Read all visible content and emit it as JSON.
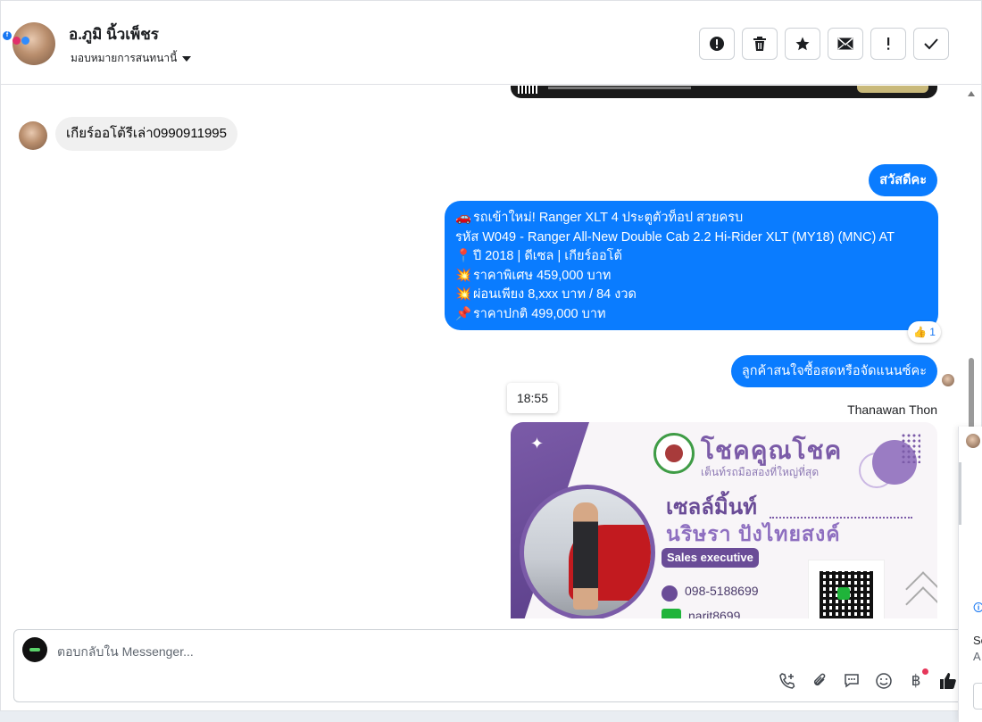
{
  "header": {
    "contact_name": "อ.ภูมิ นิ้วเพ็ชร",
    "assign_label": "มอบหมายการสนทนานี้",
    "badge_fb": "f",
    "actions": [
      {
        "name": "spam-button",
        "icon": "alert-circle-icon",
        "glyph": "!"
      },
      {
        "name": "delete-button",
        "icon": "trash-icon",
        "glyph": "🗑"
      },
      {
        "name": "star-button",
        "icon": "star-icon",
        "glyph": "★"
      },
      {
        "name": "mark-unread-button",
        "icon": "envelope-icon",
        "glyph": "✉"
      },
      {
        "name": "important-button",
        "icon": "exclamation-icon",
        "glyph": "!"
      },
      {
        "name": "mark-done-button",
        "icon": "check-icon",
        "glyph": "✓"
      }
    ]
  },
  "messages": {
    "incoming_1": "เกียร์ออโต้รีเล่า0990911995",
    "outgoing_1": "สวัสดีคะ",
    "outgoing_2": {
      "lines": [
        {
          "emoji": "🚗",
          "text": "รถเข้าใหม่! Ranger XLT 4 ประตูตัวท็อป สวยครบ"
        },
        {
          "emoji": "",
          "text": "รหัส W049 - Ranger All-New Double Cab 2.2 Hi-Rider XLT (MY18) (MNC) AT"
        },
        {
          "emoji": "📍",
          "text": "ปี 2018 | ดีเซล | เกียร์ออโต้"
        },
        {
          "emoji": "💥",
          "text": "ราคาพิเศษ 459,000 บาท"
        },
        {
          "emoji": "💥",
          "text": "ผ่อนเพียง 8,xxx บาท / 84 งวด"
        },
        {
          "emoji": "📌",
          "text": "ราคาปกติ 499,000 บาท"
        }
      ],
      "reaction": "👍 1"
    },
    "outgoing_3": "ลูกค้าสนใจซื้อสดหรือจัดแนนซ์คะ",
    "timestamp": "18:55",
    "sender_name": "Thanawan Thon"
  },
  "promo_card": {
    "sparkle": "✦",
    "brand": "โชคคูณโชค",
    "brand_sub": "เต็นท์รถมือสองที่ใหญ่ที่สุด",
    "role_line1": "เซลล์มิ้นท์",
    "role_line2": "นริษรา ปังไทยสงค์",
    "title_pill": "Sales executive",
    "phone": "098-5188699",
    "line_id": "narit8699"
  },
  "composer": {
    "placeholder": "ตอบกลับใน Messenger...",
    "tools": [
      {
        "name": "call-add-icon",
        "glyph": "📞"
      },
      {
        "name": "attach-icon",
        "glyph": "📎"
      },
      {
        "name": "saved-reply-icon",
        "glyph": "💬"
      },
      {
        "name": "emoji-icon",
        "glyph": "☺"
      },
      {
        "name": "payment-icon",
        "glyph": "฿"
      },
      {
        "name": "like-icon",
        "glyph": "👍"
      }
    ]
  },
  "side_popover": {
    "icon": "🛈",
    "text1": "Sc",
    "text2": "A"
  },
  "colors": {
    "outgoing_bubble": "#0a7cff",
    "incoming_bubble": "#f0f0f0",
    "brand_purple": "#6a4c97"
  }
}
